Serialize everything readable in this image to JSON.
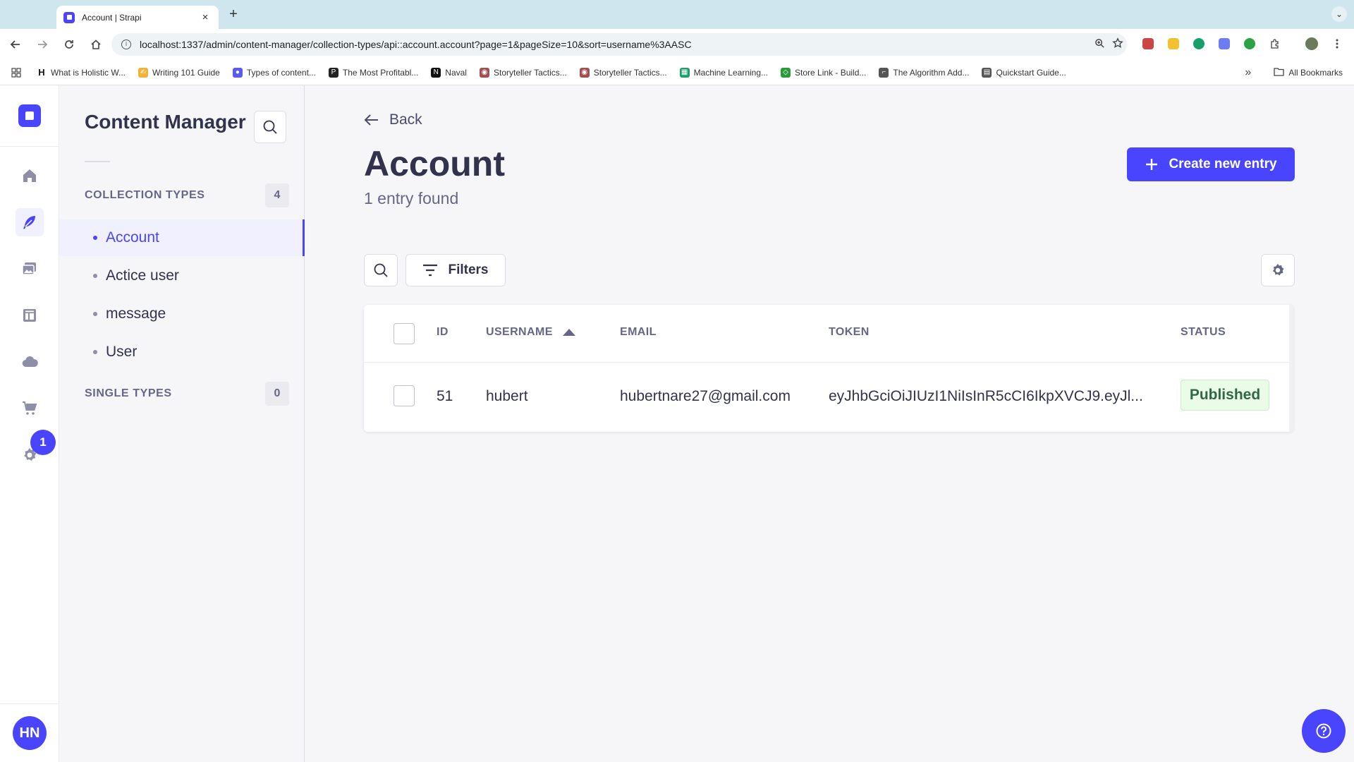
{
  "browser": {
    "tab_title": "Account | Strapi",
    "tab_close": "×",
    "new_tab": "+",
    "tab_menu": "⌄",
    "url": "localhost:1337/admin/content-manager/collection-types/api::account.account?page=1&pageSize=10&sort=username%3AASC",
    "bookmarks": [
      {
        "label": "What is Holistic W...",
        "icon_text": "H",
        "color": "#ffffff"
      },
      {
        "label": "Writing 101 Guide",
        "icon_text": "✍",
        "color": "#f3b23a"
      },
      {
        "label": "Types of content...",
        "icon_text": "●",
        "color": "#5b5bf0"
      },
      {
        "label": "The Most Profitabl...",
        "icon_text": "P",
        "color": "#222222"
      },
      {
        "label": "Naval",
        "icon_text": "N",
        "color": "#111111"
      },
      {
        "label": "Storyteller Tactics...",
        "icon_text": "◉",
        "color": "#a05050"
      },
      {
        "label": "Storyteller Tactics...",
        "icon_text": "◉",
        "color": "#a05050"
      },
      {
        "label": "Machine Learning...",
        "icon_text": "▦",
        "color": "#1f9d6e"
      },
      {
        "label": "Store Link - Build...",
        "icon_text": "◇",
        "color": "#2a9a3a"
      },
      {
        "label": "The Algorithm Add...",
        "icon_text": "⌐",
        "color": "#555555"
      },
      {
        "label": "Quickstart Guide...",
        "icon_text": "▤",
        "color": "#555555"
      }
    ],
    "bookmarks_overflow": "»",
    "all_bookmarks": "All Bookmarks"
  },
  "sidebar": {
    "title": "Content Manager",
    "collection_types_label": "COLLECTION TYPES",
    "collection_types_count": "4",
    "collection_types": [
      "Account",
      "Actice user",
      "message",
      "User"
    ],
    "active_item": "Account",
    "single_types_label": "SINGLE TYPES",
    "single_types_count": "0"
  },
  "rail": {
    "notification_count": "1",
    "user_initials": "HN"
  },
  "header": {
    "back_label": "Back",
    "title": "Account",
    "subtitle": "1 entry found",
    "create_label": "Create new entry"
  },
  "toolbar": {
    "filters_label": "Filters"
  },
  "table": {
    "columns": [
      "ID",
      "USERNAME",
      "EMAIL",
      "TOKEN",
      "STATUS"
    ],
    "rows": [
      {
        "id": "51",
        "username": "hubert",
        "email": "hubertnare27@gmail.com",
        "token": "eyJhbGciOiJIUzI1NiIsInR5cCI6IkpXVCJ9.eyJl...",
        "status": "Published"
      }
    ]
  },
  "colors": {
    "accent": "#4945ff",
    "published_bg": "#eafbe7",
    "published_text": "#2f6846"
  }
}
